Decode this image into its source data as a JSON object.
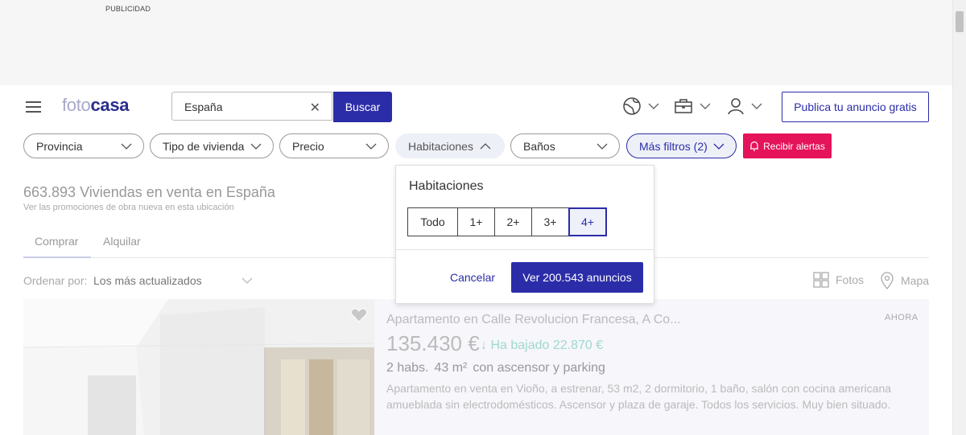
{
  "ad": {
    "label": "PUBLICIDAD"
  },
  "header": {
    "logo_part1": "foto",
    "logo_part2": "casa",
    "search_value": "España",
    "search_button": "Buscar",
    "publish_button": "Publica tu anuncio gratis"
  },
  "filters": {
    "provincia": "Provincia",
    "tipo": "Tipo de vivienda",
    "precio": "Precio",
    "habitaciones": "Habitaciones",
    "banos": "Baños",
    "mas_filtros": "Más filtros (2)",
    "alertas": "Recibir alertas"
  },
  "results": {
    "count": "663.893 Viviendas en venta en España",
    "promo_link": "Ver las promociones de obra nueva en esta ubicación",
    "tabs": [
      "Comprar",
      "Alquilar"
    ],
    "order_label": "Ordenar por:",
    "order_value": "Los más actualizados",
    "view_photos": "Fotos",
    "view_map": "Mapa"
  },
  "listing": {
    "title": "Apartamento en Calle Revolucion Francesa, A Co...",
    "price": "135.430 €",
    "drop": "↓ Ha bajado 22.870 €",
    "rooms": "2 habs.",
    "area": "43 m²",
    "extras": "con ascensor y parking",
    "description": "Apartamento en venta en Vioño, a estrenar, 53 m2, 2 dormitorio, 1 baño, salón con cocina americana amueblada sin electrodomésticos. Ascensor y plaza de garaje. Todos los servicios. Muy bien situado.",
    "time": "AHORA"
  },
  "dropdown": {
    "title": "Habitaciones",
    "options": [
      "Todo",
      "1+",
      "2+",
      "3+",
      "4+"
    ],
    "selected": "4+",
    "cancel": "Cancelar",
    "confirm": "Ver 200.543 anuncios"
  },
  "colors": {
    "brand": "#2b2da8",
    "alert": "#e5135a",
    "price_drop": "#9fd9cf"
  }
}
